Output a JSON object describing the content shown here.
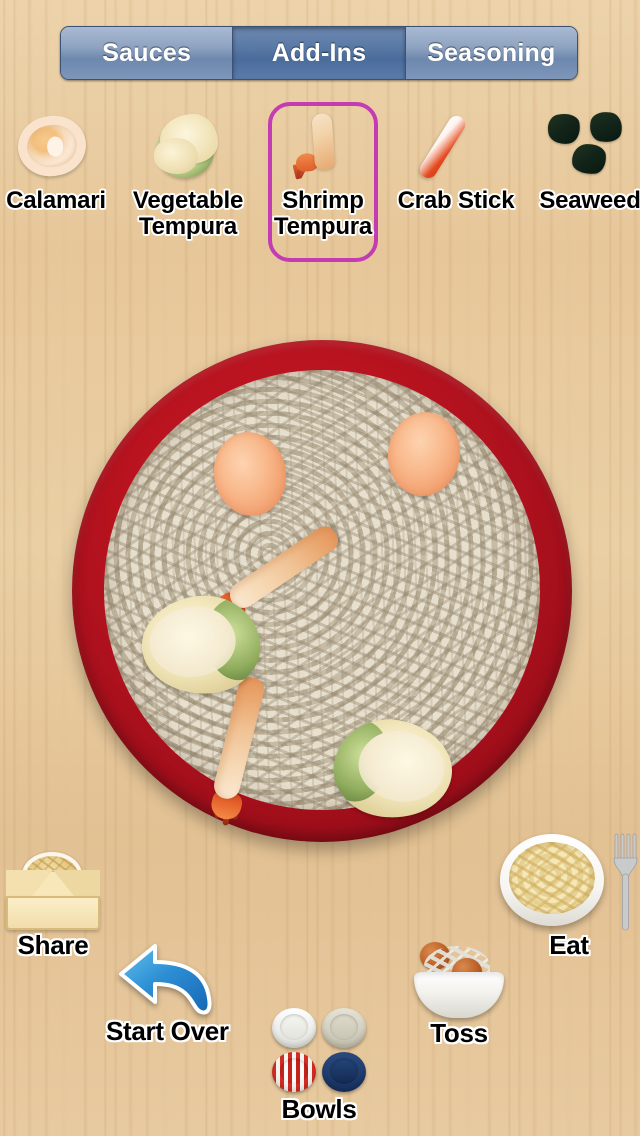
{
  "tabs": {
    "items": [
      {
        "label": "Sauces",
        "selected": false
      },
      {
        "label": "Add-Ins",
        "selected": true
      },
      {
        "label": "Seasoning",
        "selected": false
      }
    ],
    "selected_index": 1,
    "selected_color": "#4a6c9c",
    "unselected_color": "#8fa4c1"
  },
  "picker": {
    "selection_border_color": "#c33cb4",
    "items": [
      {
        "label": "Calamari",
        "icon": "calamari-icon",
        "selected": false
      },
      {
        "label": "Vegetable Tempura",
        "line1": "Vegetable",
        "line2": "Tempura",
        "icon": "vegetable-tempura-icon",
        "selected": false
      },
      {
        "label": "Shrimp Tempura",
        "line1": "Shrimp",
        "line2": "Tempura",
        "icon": "shrimp-tempura-icon",
        "selected": true
      },
      {
        "label": "Crab Stick",
        "icon": "crab-stick-icon",
        "selected": false
      },
      {
        "label": "Seaweed",
        "icon": "seaweed-icon",
        "selected": false
      }
    ]
  },
  "plate": {
    "bowl_color": "#a81020",
    "noodle_color": "#ddd5c1",
    "toppings": [
      {
        "name": "calamari",
        "count": 2
      },
      {
        "name": "shrimp-tempura",
        "count": 2
      },
      {
        "name": "vegetable-tempura",
        "count": 2
      }
    ]
  },
  "toolbar": {
    "share_label": "Share",
    "start_over_label": "Start Over",
    "bowls_label": "Bowls",
    "toss_label": "Toss",
    "eat_label": "Eat"
  },
  "bowls": {
    "swatches": [
      {
        "name": "white-bowl",
        "color": "#ffffff"
      },
      {
        "name": "beige-bowl",
        "color": "#d6d2c2"
      },
      {
        "name": "red-striped-bowl",
        "color": "#d42b22"
      },
      {
        "name": "navy-bowl",
        "color": "#1d3a६8"
      }
    ]
  }
}
